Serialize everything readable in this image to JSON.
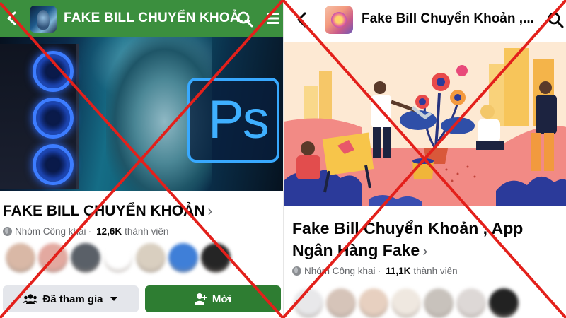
{
  "left": {
    "header": {
      "title": "FAKE BILL CHUYỂN KHOẢ...",
      "bg": "#3b8f3e"
    },
    "group_name": "FAKE BILL CHUYỂN KHOẢN",
    "chevron": "›",
    "meta": {
      "type": "Nhóm Công khai",
      "separator": "·",
      "count": "12,6K",
      "members_label": "thành viên"
    },
    "member_avatars": [
      "#d9b8a6",
      "#e3a9a0",
      "#5a6068",
      "#ffffff",
      "#d9cfc0",
      "#3f7fd8",
      "#252525"
    ],
    "buttons": {
      "joined_label": "Đã tham gia",
      "invite_label": "Mời"
    },
    "cover_icons": [
      "pc-case-icon",
      "photoshop-logo-icon"
    ],
    "cover_text": "Ps"
  },
  "right": {
    "header": {
      "title": "Fake Bill Chuyển Khoản ,..."
    },
    "group_name": "Fake Bill Chuyển Khoản , App Ngân Hàng Fake",
    "chevron": "›",
    "meta": {
      "type": "Nhóm Công khai",
      "separator": "·",
      "count": "11,1K",
      "members_label": "thành viên"
    },
    "member_avatars": [
      "#e8e8ea",
      "#d6c4b9",
      "#e7d0c0",
      "#efe8e0",
      "#c8c2bc",
      "#ddd8d6",
      "#222222"
    ]
  },
  "overlay": {
    "color": "#e3201b",
    "meaning": "cross-out"
  },
  "colors": {
    "accent_green": "#2e7d32",
    "muted_text": "#65676b"
  }
}
